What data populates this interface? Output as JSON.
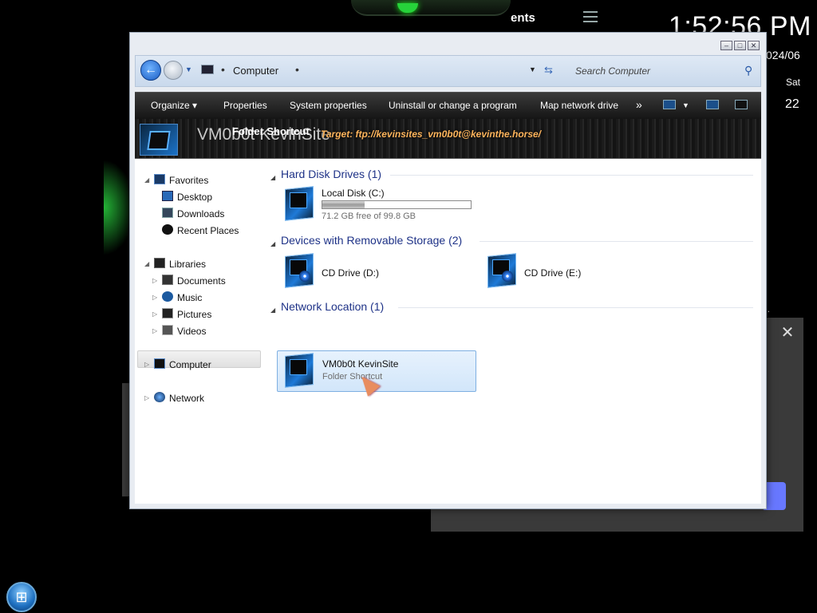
{
  "desktop": {
    "bg_text_ents": "ents",
    "clock": "1:52:56 PM",
    "date_partial": "024/06",
    "day": "Sat",
    "day_number": "22",
    "bg_e": "e.",
    "close_glyph": "✕"
  },
  "window": {
    "controls": {
      "minimize": "–",
      "maximize": "□",
      "close": "✕"
    },
    "address": {
      "back_glyph": "←",
      "location": "Computer",
      "separator": "•",
      "search_placeholder": "Search Computer"
    },
    "toolbar": {
      "organize": "Organize ▾",
      "properties": "Properties",
      "system_properties": "System properties",
      "uninstall": "Uninstall or change a program",
      "map_network_drive": "Map network drive",
      "more": "»"
    },
    "banner": {
      "name": "VM0b0t KevinSite",
      "type": "Folder Shortcut",
      "target": "Target: ftp://kevinsites_vm0b0t@kevinthe.horse/"
    },
    "nav": {
      "favorites": "Favorites",
      "desktop": "Desktop",
      "downloads": "Downloads",
      "recent_places": "Recent Places",
      "libraries": "Libraries",
      "documents": "Documents",
      "music": "Music",
      "pictures": "Pictures",
      "videos": "Videos",
      "computer": "Computer",
      "network": "Network"
    },
    "groups": {
      "hard_disk": "Hard Disk Drives (1)",
      "removable": "Devices with Removable Storage (2)",
      "network": "Network Location (1)"
    },
    "drives": {
      "local_disk": {
        "name": "Local Disk (C:)",
        "free": "71.2 GB free of 99.8 GB",
        "used_fraction": 0.287
      },
      "cd_d": "CD Drive (D:)",
      "cd_e": "CD Drive (E:)",
      "netloc": {
        "name": "VM0b0t KevinSite",
        "type": "Folder Shortcut"
      }
    }
  },
  "colors": {
    "group_header": "#1e3287",
    "banner_target": "#ffb55c",
    "selection": "#d2e6fa"
  }
}
